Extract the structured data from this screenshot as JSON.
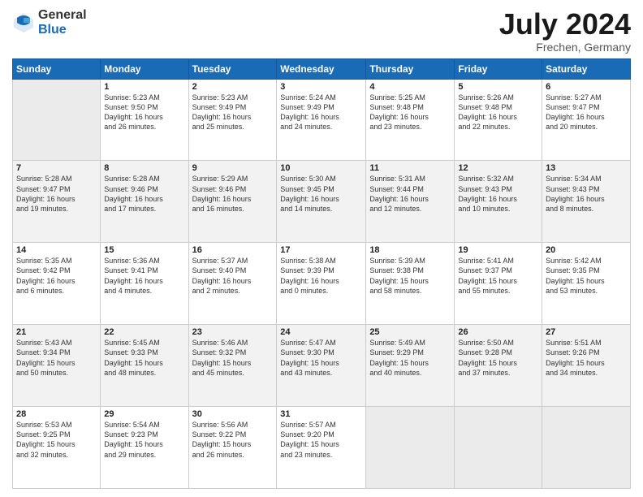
{
  "logo": {
    "general": "General",
    "blue": "Blue"
  },
  "title": "July 2024",
  "subtitle": "Frechen, Germany",
  "days_header": [
    "Sunday",
    "Monday",
    "Tuesday",
    "Wednesday",
    "Thursday",
    "Friday",
    "Saturday"
  ],
  "weeks": [
    [
      {
        "day": "",
        "info": ""
      },
      {
        "day": "1",
        "info": "Sunrise: 5:23 AM\nSunset: 9:50 PM\nDaylight: 16 hours\nand 26 minutes."
      },
      {
        "day": "2",
        "info": "Sunrise: 5:23 AM\nSunset: 9:49 PM\nDaylight: 16 hours\nand 25 minutes."
      },
      {
        "day": "3",
        "info": "Sunrise: 5:24 AM\nSunset: 9:49 PM\nDaylight: 16 hours\nand 24 minutes."
      },
      {
        "day": "4",
        "info": "Sunrise: 5:25 AM\nSunset: 9:48 PM\nDaylight: 16 hours\nand 23 minutes."
      },
      {
        "day": "5",
        "info": "Sunrise: 5:26 AM\nSunset: 9:48 PM\nDaylight: 16 hours\nand 22 minutes."
      },
      {
        "day": "6",
        "info": "Sunrise: 5:27 AM\nSunset: 9:47 PM\nDaylight: 16 hours\nand 20 minutes."
      }
    ],
    [
      {
        "day": "7",
        "info": "Sunrise: 5:28 AM\nSunset: 9:47 PM\nDaylight: 16 hours\nand 19 minutes."
      },
      {
        "day": "8",
        "info": "Sunrise: 5:28 AM\nSunset: 9:46 PM\nDaylight: 16 hours\nand 17 minutes."
      },
      {
        "day": "9",
        "info": "Sunrise: 5:29 AM\nSunset: 9:46 PM\nDaylight: 16 hours\nand 16 minutes."
      },
      {
        "day": "10",
        "info": "Sunrise: 5:30 AM\nSunset: 9:45 PM\nDaylight: 16 hours\nand 14 minutes."
      },
      {
        "day": "11",
        "info": "Sunrise: 5:31 AM\nSunset: 9:44 PM\nDaylight: 16 hours\nand 12 minutes."
      },
      {
        "day": "12",
        "info": "Sunrise: 5:32 AM\nSunset: 9:43 PM\nDaylight: 16 hours\nand 10 minutes."
      },
      {
        "day": "13",
        "info": "Sunrise: 5:34 AM\nSunset: 9:43 PM\nDaylight: 16 hours\nand 8 minutes."
      }
    ],
    [
      {
        "day": "14",
        "info": "Sunrise: 5:35 AM\nSunset: 9:42 PM\nDaylight: 16 hours\nand 6 minutes."
      },
      {
        "day": "15",
        "info": "Sunrise: 5:36 AM\nSunset: 9:41 PM\nDaylight: 16 hours\nand 4 minutes."
      },
      {
        "day": "16",
        "info": "Sunrise: 5:37 AM\nSunset: 9:40 PM\nDaylight: 16 hours\nand 2 minutes."
      },
      {
        "day": "17",
        "info": "Sunrise: 5:38 AM\nSunset: 9:39 PM\nDaylight: 16 hours\nand 0 minutes."
      },
      {
        "day": "18",
        "info": "Sunrise: 5:39 AM\nSunset: 9:38 PM\nDaylight: 15 hours\nand 58 minutes."
      },
      {
        "day": "19",
        "info": "Sunrise: 5:41 AM\nSunset: 9:37 PM\nDaylight: 15 hours\nand 55 minutes."
      },
      {
        "day": "20",
        "info": "Sunrise: 5:42 AM\nSunset: 9:35 PM\nDaylight: 15 hours\nand 53 minutes."
      }
    ],
    [
      {
        "day": "21",
        "info": "Sunrise: 5:43 AM\nSunset: 9:34 PM\nDaylight: 15 hours\nand 50 minutes."
      },
      {
        "day": "22",
        "info": "Sunrise: 5:45 AM\nSunset: 9:33 PM\nDaylight: 15 hours\nand 48 minutes."
      },
      {
        "day": "23",
        "info": "Sunrise: 5:46 AM\nSunset: 9:32 PM\nDaylight: 15 hours\nand 45 minutes."
      },
      {
        "day": "24",
        "info": "Sunrise: 5:47 AM\nSunset: 9:30 PM\nDaylight: 15 hours\nand 43 minutes."
      },
      {
        "day": "25",
        "info": "Sunrise: 5:49 AM\nSunset: 9:29 PM\nDaylight: 15 hours\nand 40 minutes."
      },
      {
        "day": "26",
        "info": "Sunrise: 5:50 AM\nSunset: 9:28 PM\nDaylight: 15 hours\nand 37 minutes."
      },
      {
        "day": "27",
        "info": "Sunrise: 5:51 AM\nSunset: 9:26 PM\nDaylight: 15 hours\nand 34 minutes."
      }
    ],
    [
      {
        "day": "28",
        "info": "Sunrise: 5:53 AM\nSunset: 9:25 PM\nDaylight: 15 hours\nand 32 minutes."
      },
      {
        "day": "29",
        "info": "Sunrise: 5:54 AM\nSunset: 9:23 PM\nDaylight: 15 hours\nand 29 minutes."
      },
      {
        "day": "30",
        "info": "Sunrise: 5:56 AM\nSunset: 9:22 PM\nDaylight: 15 hours\nand 26 minutes."
      },
      {
        "day": "31",
        "info": "Sunrise: 5:57 AM\nSunset: 9:20 PM\nDaylight: 15 hours\nand 23 minutes."
      },
      {
        "day": "",
        "info": ""
      },
      {
        "day": "",
        "info": ""
      },
      {
        "day": "",
        "info": ""
      }
    ]
  ]
}
